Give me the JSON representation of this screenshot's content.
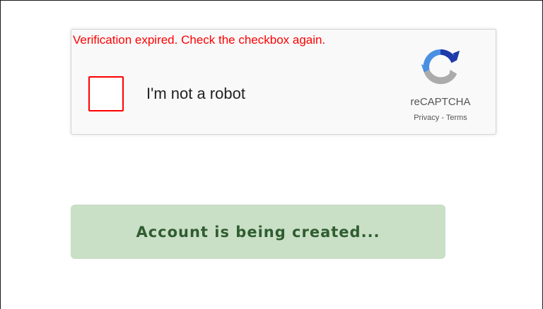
{
  "recaptcha": {
    "expired_message": "Verification expired. Check the checkbox again.",
    "checkbox_label": "I'm not a robot",
    "brand_name": "reCAPTCHA",
    "privacy_link": "Privacy",
    "separator": " - ",
    "terms_link": "Terms",
    "error_color": "#ff0000",
    "logo_icon": "recaptcha-logo-icon"
  },
  "status": {
    "message": "Account is being created...",
    "background_color": "#c9dfc6",
    "text_color": "#2f5d30"
  }
}
